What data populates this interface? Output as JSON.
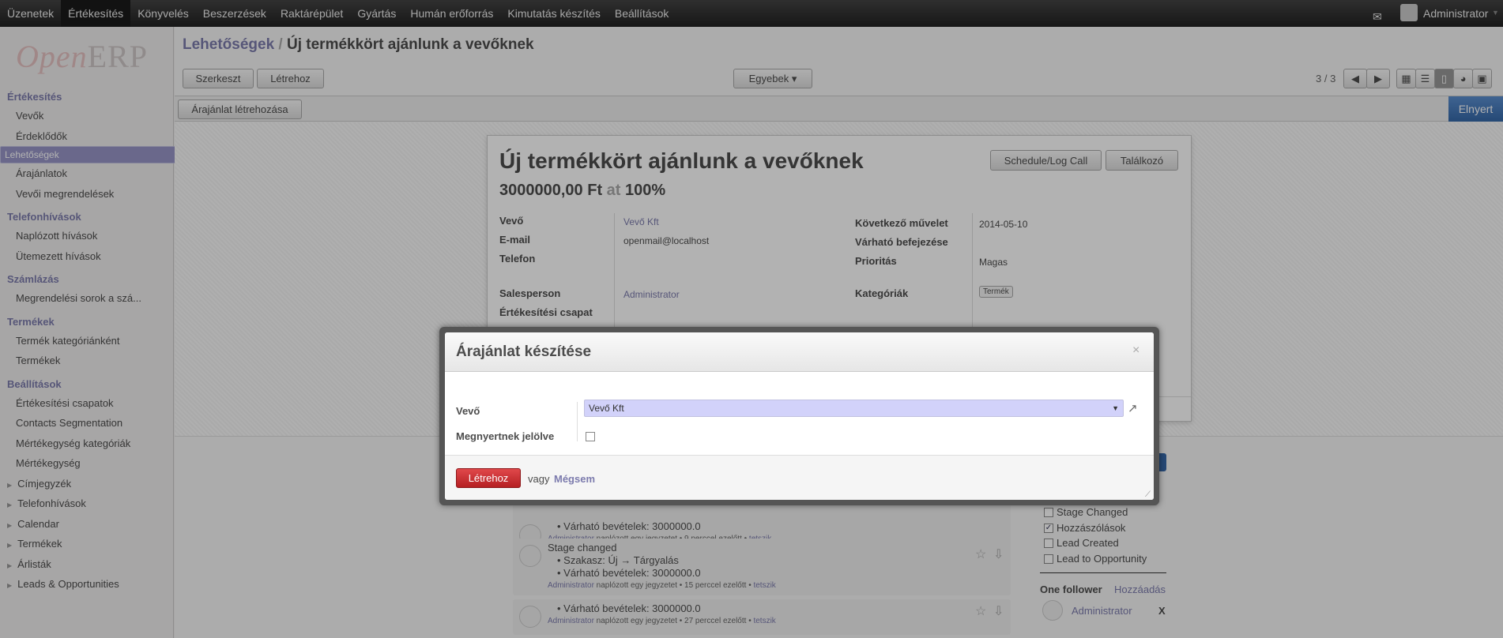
{
  "topbar": {
    "menu": [
      "Üzenetek",
      "Értékesítés",
      "Könyvelés",
      "Beszerzések",
      "Raktárépület",
      "Gyártás",
      "Humán erőforrás",
      "Kimutatás készítés",
      "Beállítások"
    ],
    "active": "Értékesítés",
    "user": "Administrator"
  },
  "logo": {
    "text": "OpenERP"
  },
  "sidebar": {
    "sections": [
      {
        "title": "Értékesítés",
        "items": [
          "Vevők",
          "Érdeklődők",
          "Lehetőségek",
          "Árajánlatok",
          "Vevői megrendelések"
        ]
      },
      {
        "title": "Telefonhívások",
        "items": [
          "Naplózott hívások",
          "Ütemezett hívások"
        ]
      },
      {
        "title": "Számlázás",
        "items": [
          "Megrendelési sorok a szá..."
        ]
      },
      {
        "title": "Termékek",
        "items": [
          "Termék kategóriánként",
          "Termékek"
        ]
      },
      {
        "title": "Beállítások",
        "items": [
          "Értékesítési csapatok",
          "Contacts Segmentation",
          "Mértékegység kategóriák",
          "Mértékegység"
        ]
      }
    ],
    "selected": "Lehetőségek",
    "collapsed": [
      "Címjegyzék",
      "Telefonhívások",
      "Calendar",
      "Termékek",
      "Árlisták",
      "Leads & Opportunities"
    ]
  },
  "header": {
    "breadcrumb_parent": "Lehetőségek",
    "breadcrumb_sep": " / ",
    "breadcrumb_current": "Új termékkört ajánlunk a vevőknek",
    "edit": "Szerkeszt",
    "create": "Létrehoz",
    "more": "Egyebek ▾",
    "pager": "3 / 3"
  },
  "actionbar": {
    "quote": "Árajánlat létrehozása",
    "stage": "Elnyert"
  },
  "form": {
    "title": "Új termékkört ajánlunk a vevőknek",
    "amount": "3000000,00 Ft",
    "at": "at",
    "probability": "100%",
    "schedule": "Schedule/Log Call",
    "meeting": "Találkozó",
    "left": [
      {
        "label": "Vevő",
        "value": "Vevő Kft",
        "link": true
      },
      {
        "label": "E-mail",
        "value": "openmail@localhost"
      },
      {
        "label": "Telefon",
        "value": ""
      },
      {
        "label": "Salesperson",
        "value": "Administrator",
        "link": true
      },
      {
        "label": "Értékesítési csapat",
        "value": ""
      }
    ],
    "right": [
      {
        "label": "Következő művelet",
        "value": "2014-05-10"
      },
      {
        "label": "Várható befejezése",
        "value": ""
      },
      {
        "label": "Prioritás",
        "value": "Magas"
      },
      {
        "label": "Kategóriák",
        "tag": "Termék"
      }
    ]
  },
  "chatter": {
    "messages": [
      {
        "lines": [
          "• Várható bevételek: 3000000.0"
        ],
        "author": "Administrator",
        "meta": " naplózott egy jegyzetet • 9 perccel ezelőtt • ",
        "like": "tetszik"
      },
      {
        "title": "Stage changed",
        "lines": [
          "• Szakasz: Új → Tárgyalás",
          "• Várható bevételek: 3000000.0"
        ],
        "author": "Administrator",
        "meta": " naplózott egy jegyzetet • 15 perccel ezelőtt • ",
        "like": "tetszik"
      },
      {
        "lines": [
          "• Várható bevételek: 3000000.0"
        ],
        "author": "Administrator",
        "meta": " naplózott egy jegyzetet • 27 perccel ezelőtt • ",
        "like": "tetszik"
      }
    ],
    "subtypes": [
      {
        "label": "Stage Changed",
        "checked": false
      },
      {
        "label": "Hozzászólások",
        "checked": true
      },
      {
        "label": "Lead Created",
        "checked": false
      },
      {
        "label": "Lead to Opportunity",
        "checked": false
      }
    ],
    "followers_title": "One follower",
    "add_follower": "Hozzáadás",
    "follower": "Administrator",
    "remove": "X"
  },
  "modal": {
    "title": "Árajánlat készítése",
    "close": "×",
    "customer_label": "Vevő",
    "customer_value": "Vevő Kft",
    "won_label": "Megnyertnek jelölve",
    "won_checked": false,
    "create": "Létrehoz",
    "or": "vagy",
    "cancel": "Mégsem"
  },
  "colors": {
    "accent": "#7c7bad",
    "danger": "#c9302c",
    "stage": "#3568a8",
    "select_bg": "#d2d2fa"
  }
}
